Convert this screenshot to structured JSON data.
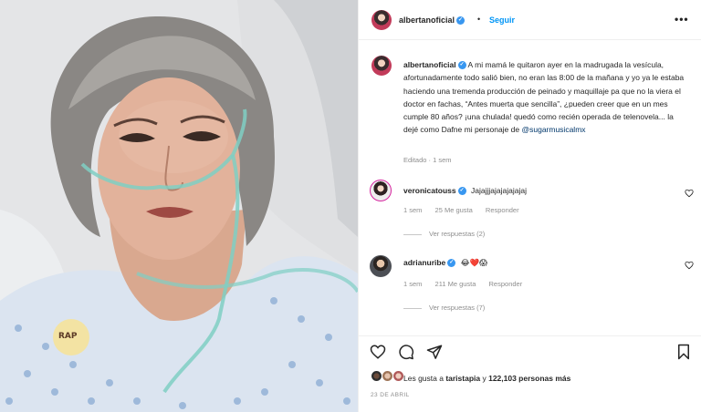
{
  "post": {
    "author": "albertanoficial",
    "separator": "•",
    "follow_label": "Seguir",
    "more_label": "•••",
    "caption_author": "albertanoficial",
    "caption_text": "A mi mamá le quitaron ayer en la madrugada la vesícula, afortunadamente todo salió bien, no eran las 8:00 de la mañana y yo ya le estaba haciendo una tremenda producción de peinado y maquillaje pa que no la viera el doctor en fachas, “Antes muerta que sencilla”, ¿pueden creer que en un mes cumple 80 años? ¡una chulada! quedó como recién operada de telenovela... la dejé como Dafne mi personaje de",
    "caption_mention": "@sugarmusicalmx",
    "caption_meta": "Editado · 1 sem"
  },
  "comments": [
    {
      "user": "veronicatouss",
      "text": "Jajajjjajajajajajaj",
      "age": "1 sem",
      "likes": "25 Me gusta",
      "reply_label": "Responder",
      "view_replies": "Ver respuestas (2)"
    },
    {
      "user": "adrianuribe",
      "text": "😂❤️😱",
      "age": "1 sem",
      "likes": "211 Me gusta",
      "reply_label": "Responder",
      "view_replies": "Ver respuestas (7)"
    }
  ],
  "likes": {
    "prefix": "Les gusta a ",
    "user": "taristapia",
    "middle": " y ",
    "count": "122,103 personas más"
  },
  "date": "23 DE ABRIL",
  "photo": {
    "pin_text": "RAP"
  },
  "colors": {
    "accent": "#0095f6",
    "verified": "#3897f0",
    "muted": "#8e8e8e",
    "text": "#262626"
  },
  "icons": [
    "heart-icon",
    "comment-icon",
    "share-icon",
    "bookmark-icon",
    "more-icon",
    "verified-icon"
  ]
}
